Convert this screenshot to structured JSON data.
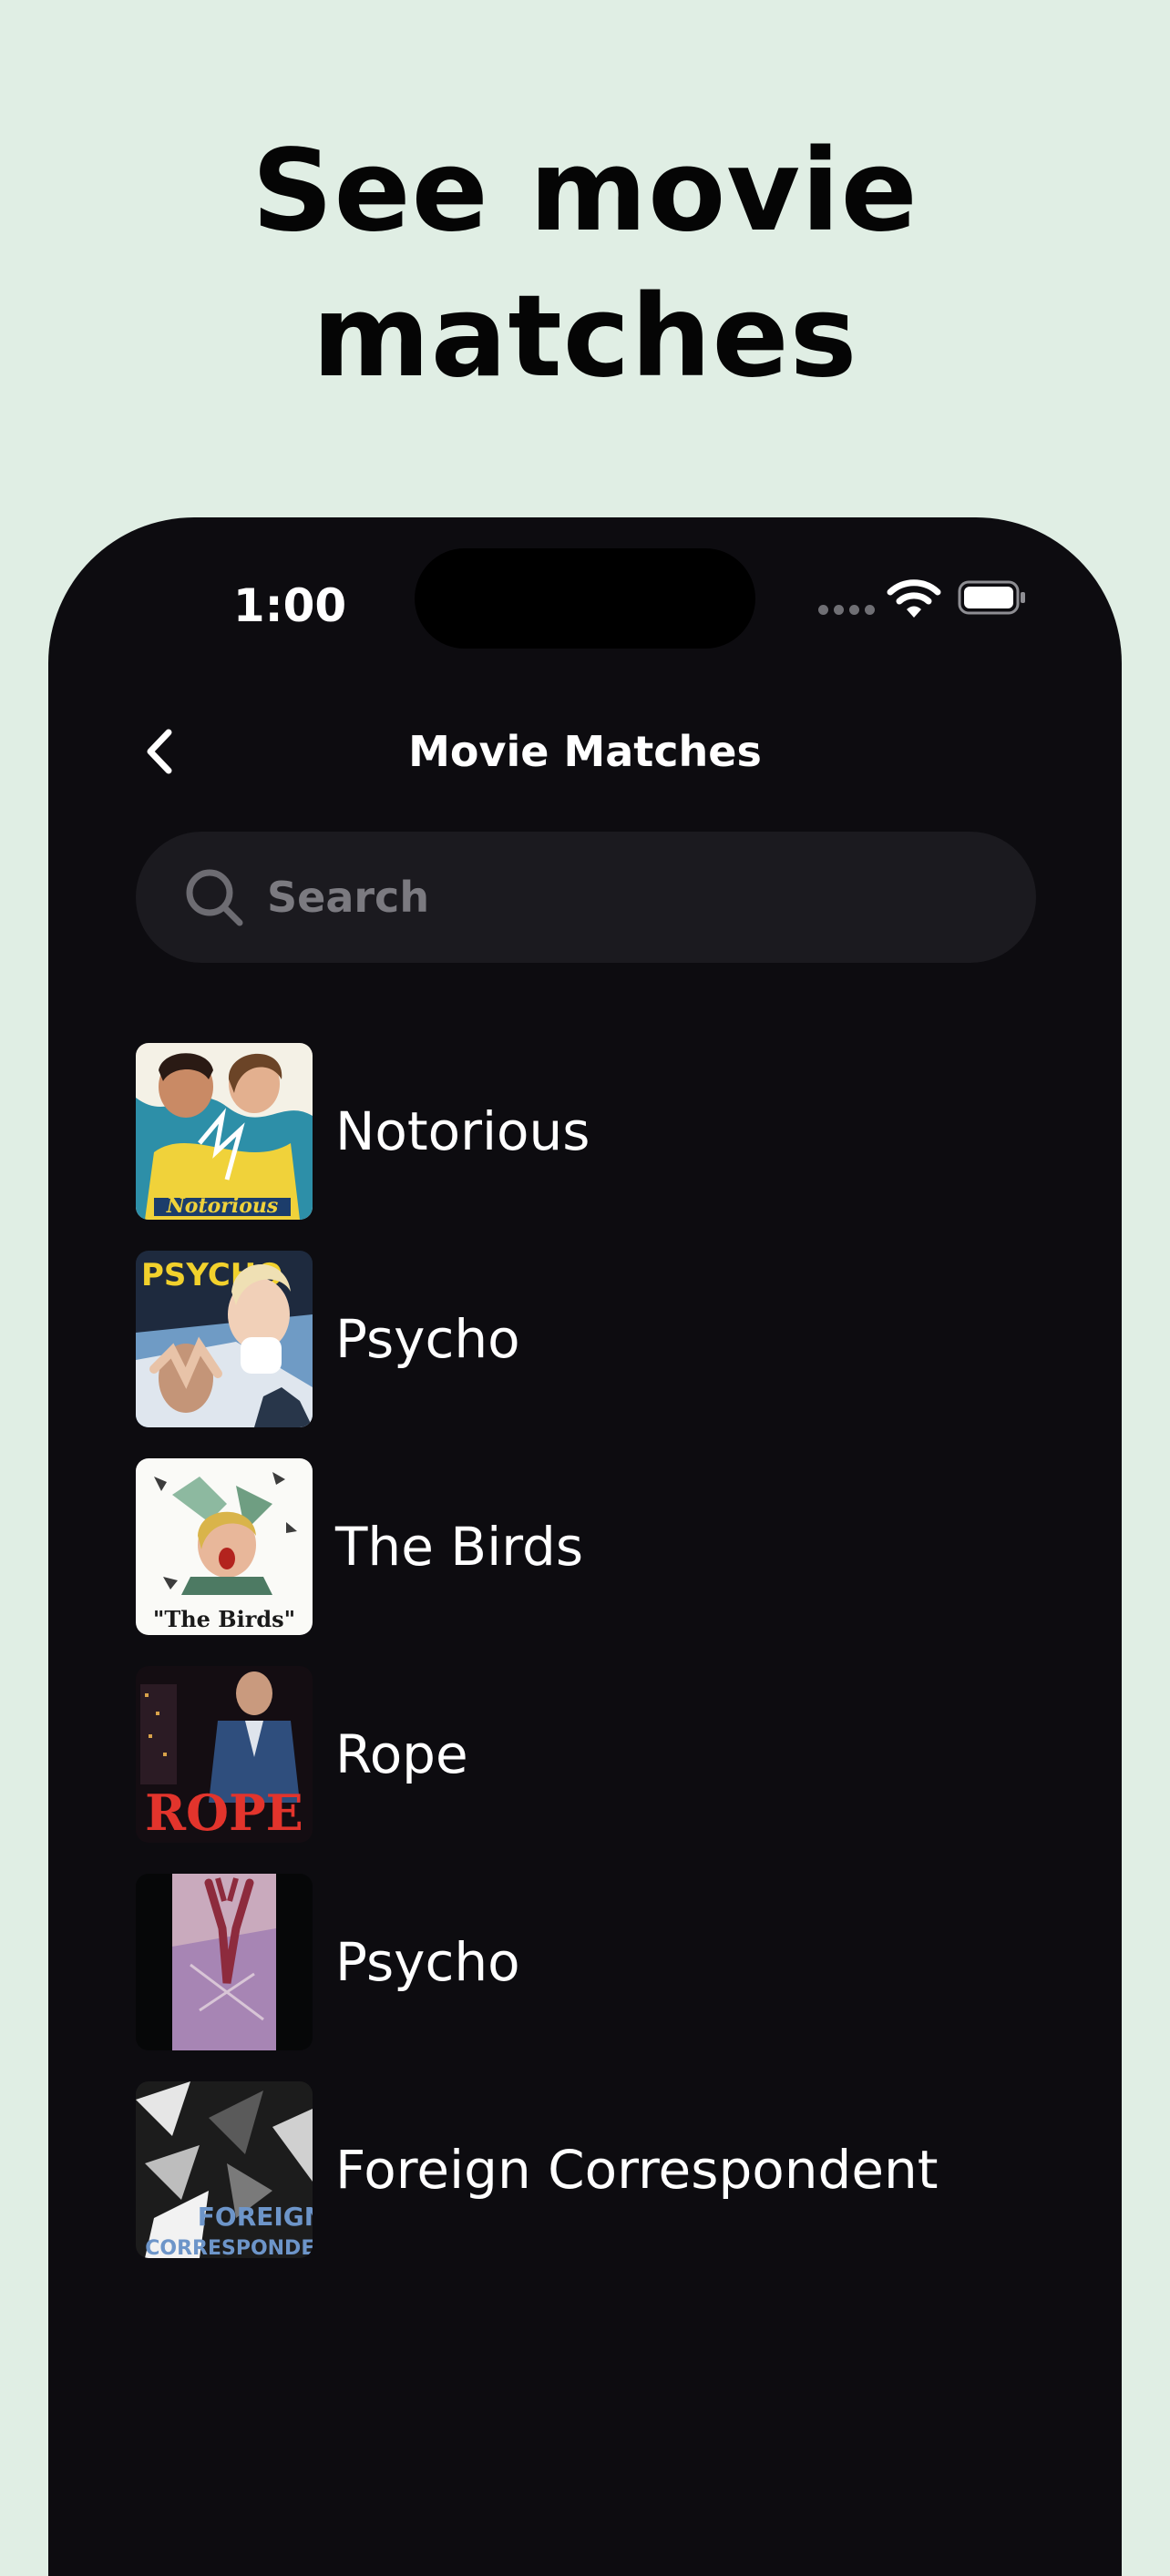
{
  "headline": {
    "line1": "See movie",
    "line2": "matches"
  },
  "status_bar": {
    "time": "1:00"
  },
  "nav": {
    "title": "Movie Matches",
    "back_icon": "chevron-left-icon"
  },
  "search": {
    "placeholder": "Search",
    "value": "",
    "icon": "search-icon"
  },
  "colors": {
    "background": "#e0eee4",
    "phone": "#0d0c10",
    "search_field": "#1b1a1f",
    "text": "#ffffff",
    "placeholder": "#7b7a80"
  },
  "movies": [
    {
      "title": "Notorious"
    },
    {
      "title": "Psycho"
    },
    {
      "title": "The Birds"
    },
    {
      "title": "Rope"
    },
    {
      "title": "Psycho"
    },
    {
      "title": "Foreign Correspondent"
    }
  ]
}
